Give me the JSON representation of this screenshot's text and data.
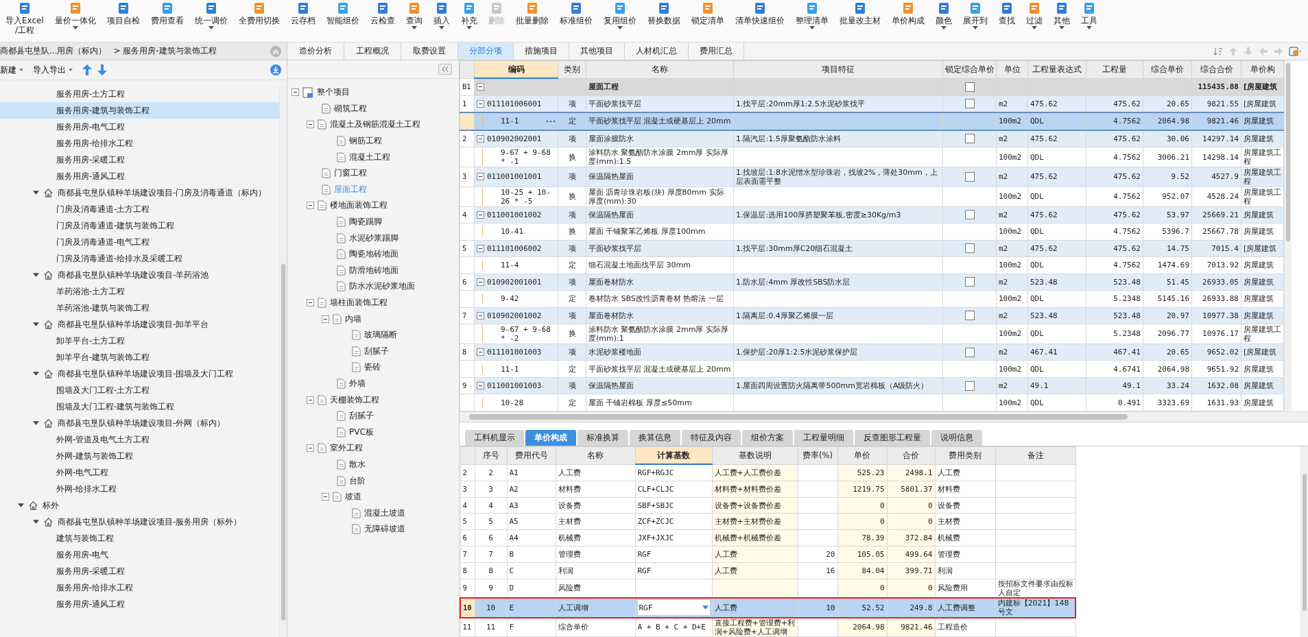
{
  "toolbar": [
    {
      "label": "导入Excel\n/工程",
      "dropdown": false,
      "disabled": false
    },
    {
      "label": "量价一体化",
      "dropdown": true,
      "disabled": false
    },
    {
      "label": "项目自检",
      "dropdown": false,
      "disabled": false
    },
    {
      "label": "费用查看",
      "dropdown": false,
      "disabled": false
    },
    {
      "label": "统一调价",
      "dropdown": true,
      "disabled": false
    },
    {
      "label": "全费用切换",
      "dropdown": false,
      "disabled": false
    },
    {
      "label": "云存档",
      "dropdown": false,
      "disabled": false
    },
    {
      "label": "智能组价",
      "dropdown": false,
      "disabled": false
    },
    {
      "label": "云检查",
      "dropdown": false,
      "disabled": false
    },
    {
      "label": "查询",
      "dropdown": true,
      "disabled": false
    },
    {
      "label": "插入",
      "dropdown": true,
      "disabled": false
    },
    {
      "label": "补充",
      "dropdown": true,
      "disabled": false
    },
    {
      "label": "删除",
      "dropdown": false,
      "disabled": true
    },
    {
      "label": "批量删除",
      "dropdown": false,
      "disabled": false
    },
    {
      "label": "标准组价",
      "dropdown": false,
      "disabled": false
    },
    {
      "label": "复用组价",
      "dropdown": true,
      "disabled": false
    },
    {
      "label": "替换数据",
      "dropdown": false,
      "disabled": false
    },
    {
      "label": "锁定清单",
      "dropdown": false,
      "disabled": false
    },
    {
      "label": "清单快速组价",
      "dropdown": false,
      "disabled": false
    },
    {
      "label": "整理清单",
      "dropdown": true,
      "disabled": false
    },
    {
      "label": "批量改主材",
      "dropdown": false,
      "disabled": false
    },
    {
      "label": "单价构成",
      "dropdown": false,
      "disabled": false
    },
    {
      "label": "颜色",
      "dropdown": true,
      "disabled": false
    },
    {
      "label": "展开到",
      "dropdown": true,
      "disabled": false
    },
    {
      "label": "查找",
      "dropdown": false,
      "disabled": false
    },
    {
      "label": "过滤",
      "dropdown": true,
      "disabled": false
    },
    {
      "label": "其他",
      "dropdown": true,
      "disabled": false
    },
    {
      "label": "工具",
      "dropdown": true,
      "disabled": false
    }
  ],
  "left_panel": {
    "breadcrumb": {
      "project": "商都县屯垦队...用房（标内）",
      "path": "> 服务用房-建筑与装饰工程"
    },
    "actions": [
      "新建",
      "导入导出"
    ],
    "tree": [
      {
        "children": [
          {
            "children": [
              {
                "label": "服务用房-土方工程",
                "selected": false
              },
              {
                "label": "服务用房-建筑与装饰工程",
                "selected": true
              },
              {
                "label": "服务用房-电气工程",
                "selected": false
              },
              {
                "label": "服务用房-给排水工程",
                "selected": false
              },
              {
                "label": "服务用房-采暖工程",
                "selected": false
              },
              {
                "label": "服务用房-通风工程",
                "selected": false
              }
            ]
          },
          {
            "label": "商都县屯垦队镇种羊场建设项目-门房及消毒通道（标内）",
            "selected": false,
            "expanded": true,
            "children": [
              {
                "label": "门房及消毒通道-土方工程",
                "selected": false
              },
              {
                "label": "门房及消毒通道-建筑与装饰工程",
                "selected": false
              },
              {
                "label": "门房及消毒通道-电气工程",
                "selected": false
              },
              {
                "label": "门房及消毒通道-给排水及采暖工程",
                "selected": false
              }
            ]
          },
          {
            "label": "商都县屯垦队镇种羊场建设项目-羊药浴池",
            "selected": false,
            "expanded": true,
            "children": [
              {
                "label": "羊药浴池-土方工程",
                "selected": false
              },
              {
                "label": "羊药浴池-建筑与装饰工程",
                "selected": false
              }
            ]
          },
          {
            "label": "商都县屯垦队镇种羊场建设项目-卸羊平台",
            "selected": false,
            "expanded": true,
            "children": [
              {
                "label": "卸羊平台-土方工程",
                "selected": false
              },
              {
                "label": "卸羊平台-建筑与装饰工程",
                "selected": false
              }
            ]
          },
          {
            "label": "商都县屯垦队镇种羊场建设项目-围墙及大门工程",
            "selected": false,
            "expanded": true,
            "children": [
              {
                "label": "围墙及大门工程-土方工程",
                "selected": false
              },
              {
                "label": "围墙及大门工程-建筑与装饰工程",
                "selected": false
              }
            ]
          },
          {
            "label": "商都县屯垦队镇种羊场建设项目-外网（标内）",
            "selected": false,
            "expanded": true,
            "children": [
              {
                "label": "外网-管道及电气土方工程",
                "selected": false
              },
              {
                "label": "外网-建筑与装饰工程",
                "selected": false
              },
              {
                "label": "外网-电气工程",
                "selected": false
              },
              {
                "label": "外网-给排水工程",
                "selected": false
              }
            ]
          }
        ]
      },
      {
        "label": "标外",
        "selected": false,
        "expanded": true,
        "children": [
          {
            "label": "商都县屯垦队镇种羊场建设项目-服务用房（标外）",
            "selected": false,
            "expanded": true,
            "children": [
              {
                "label": "建筑与装饰工程",
                "selected": false
              },
              {
                "label": "服务用房-电气",
                "selected": false
              },
              {
                "label": "服务用房-采暖工程",
                "selected": false
              },
              {
                "label": "服务用房-给排水工程",
                "selected": false
              },
              {
                "label": "服务用房-通风工程",
                "selected": false
              }
            ]
          }
        ]
      }
    ]
  },
  "tabs": [
    {
      "label": "造价分析",
      "selected": false
    },
    {
      "label": "工程概况",
      "selected": false
    },
    {
      "label": "取费设置",
      "selected": false
    },
    {
      "label": "分部分项",
      "selected": true
    },
    {
      "label": "措施项目",
      "selected": false
    },
    {
      "label": "其他项目",
      "selected": false
    },
    {
      "label": "人材机汇总",
      "selected": false
    },
    {
      "label": "费用汇总",
      "selected": false
    }
  ],
  "project_tree": [
    {
      "label": "整个项目",
      "kind": "root",
      "selected": false,
      "expanded": true,
      "children": [
        {
          "label": "砌筑工程",
          "selected": false
        },
        {
          "label": "混凝土及钢筋混凝土工程",
          "selected": false,
          "expanded": true,
          "children": [
            {
              "label": "钢筋工程",
              "selected": false
            },
            {
              "label": "混凝土工程",
              "selected": false
            }
          ]
        },
        {
          "label": "门窗工程",
          "selected": false
        },
        {
          "label": "屋面工程",
          "selected": true
        },
        {
          "label": "楼地面装饰工程",
          "selected": false,
          "expanded": true,
          "children": [
            {
              "label": "陶瓷踢脚",
              "selected": false
            },
            {
              "label": "水泥砂浆踢脚",
              "selected": false
            },
            {
              "label": "陶瓷地砖地面",
              "selected": false
            },
            {
              "label": "防滑地砖地面",
              "selected": false
            },
            {
              "label": "防水水泥砂浆地面",
              "selected": false
            }
          ]
        },
        {
          "label": "墙柱面装饰工程",
          "selected": false,
          "expanded": true,
          "children": [
            {
              "label": "内墙",
              "selected": false,
              "expanded": true,
              "children": [
                {
                  "label": "玻璃隔断",
                  "selected": false
                },
                {
                  "label": "刮腻子",
                  "selected": false
                },
                {
                  "label": "瓷砖",
                  "selected": false
                }
              ]
            },
            {
              "label": "外墙",
              "selected": false
            }
          ]
        },
        {
          "label": "天棚装饰工程",
          "selected": false,
          "expanded": true,
          "children": [
            {
              "label": "刮腻子",
              "selected": false
            },
            {
              "label": "PVC板",
              "selected": false
            }
          ]
        },
        {
          "label": "室外工程",
          "selected": false,
          "expanded": true,
          "children": [
            {
              "label": "散水",
              "selected": false
            },
            {
              "label": "台阶",
              "selected": false
            },
            {
              "label": "坡道",
              "selected": false,
              "expanded": true,
              "children": [
                {
                  "label": "混凝土坡道",
                  "selected": false
                },
                {
                  "label": "无障碍坡道",
                  "selected": false
                }
              ]
            }
          ]
        }
      ]
    }
  ],
  "upper_table": {
    "columns": [
      {
        "label": "编码",
        "active": true
      },
      {
        "label": "类别",
        "active": false
      },
      {
        "label": "名称",
        "active": false
      },
      {
        "label": "项目特征",
        "active": false
      },
      {
        "label": "锁定综合单价",
        "active": false
      },
      {
        "label": "单位",
        "active": false
      },
      {
        "label": "工程量表达式",
        "active": false
      },
      {
        "label": "工程量",
        "active": false
      },
      {
        "label": "综合单价",
        "active": false
      },
      {
        "label": "综合合价",
        "active": false
      },
      {
        "label": "单价构",
        "active": false
      }
    ],
    "rows": [
      {
        "kind": "group",
        "seq": "B1",
        "expanded": true,
        "name": "屋面工程",
        "locked": false,
        "total": "115435.88",
        "build": "[房屋建筑",
        "selected": false
      },
      {
        "kind": "item",
        "seq": "1",
        "expanded": true,
        "code": "011101006001",
        "type": "项",
        "name": "平面砂浆找平层",
        "feature": "1.找平层:20mm厚1:2.5水泥砂浆找平",
        "locked": false,
        "unit": "m2",
        "expr": "475.62",
        "qty": "475.62",
        "price": "20.65",
        "total": "9821.55",
        "build": "[房屋建筑",
        "selected": false
      },
      {
        "kind": "sub",
        "code": "11-1",
        "type": "定",
        "name": "平面砂浆找平层 混凝土或硬基层上 20mm",
        "unit": "100m2",
        "expr": "QDL",
        "qty": "4.7562",
        "price": "2064.98",
        "total": "9821.46",
        "build": "房屋建筑",
        "selected": true
      },
      {
        "kind": "item",
        "seq": "2",
        "expanded": true,
        "code": "010902002001",
        "type": "项",
        "name": "屋面涂膜防水",
        "feature": "1.隔汽层:1.5厚聚氨酯防水涂料",
        "locked": false,
        "unit": "m2",
        "expr": "475.62",
        "qty": "475.62",
        "price": "30.06",
        "total": "14297.14",
        "build": "房屋建筑",
        "selected": false
      },
      {
        "kind": "sub",
        "code": "9-67 + 9-68 * -1",
        "type": "换",
        "name": "涂料防水 聚氨酯防水涂膜 2mm厚  实际厚度(mm):1.5",
        "unit": "100m2",
        "expr": "QDL",
        "qty": "4.7562",
        "price": "3006.21",
        "total": "14298.14",
        "build": "房屋建筑工程",
        "selected": false
      },
      {
        "kind": "item",
        "seq": "3",
        "expanded": true,
        "code": "011001001001",
        "type": "项",
        "name": "保温隔热屋面",
        "feature": "1.找坡层:1:8水泥憎水型珍珠岩，找坡2%，薄处30mm，上层表面需平整",
        "locked": false,
        "unit": "m2",
        "expr": "475.62",
        "qty": "475.62",
        "price": "9.52",
        "total": "4527.9",
        "build": "房屋建筑工程",
        "selected": false
      },
      {
        "kind": "sub",
        "code": "10-25 + 10-26 * -5",
        "type": "换",
        "name": "屋面 沥青珍珠岩板(块) 厚度80mm  实际厚度(mm):30",
        "unit": "100m2",
        "expr": "QDL",
        "qty": "4.7562",
        "price": "952.07",
        "total": "4528.24",
        "build": "房屋建筑工程",
        "selected": false
      },
      {
        "kind": "item",
        "seq": "4",
        "expanded": true,
        "code": "011001001002",
        "type": "项",
        "name": "保温隔热屋面",
        "feature": "1.保温层:选用100厚挤塑聚苯板,密度≥30Kg/m3",
        "locked": false,
        "unit": "m2",
        "expr": "475.62",
        "qty": "475.62",
        "price": "53.97",
        "total": "25669.21",
        "build": "房屋建筑",
        "selected": false
      },
      {
        "kind": "sub",
        "code": "10-41",
        "type": "换",
        "name": "屋面 干铺聚苯乙烯板 厚度100mm",
        "unit": "100m2",
        "expr": "QDL",
        "qty": "4.7562",
        "price": "5396.7",
        "total": "25667.78",
        "build": "房屋建筑",
        "selected": false
      },
      {
        "kind": "item",
        "seq": "5",
        "expanded": true,
        "code": "011101006002",
        "type": "项",
        "name": "平面砂浆找平层",
        "feature": "1.找平层:30mm厚C20细石混凝土",
        "locked": false,
        "unit": "m2",
        "expr": "475.62",
        "qty": "475.62",
        "price": "14.75",
        "total": "7015.4",
        "build": "[房屋建筑",
        "selected": false
      },
      {
        "kind": "sub",
        "code": "11-4",
        "type": "定",
        "name": "细石混凝土地面找平层 30mm",
        "unit": "100m2",
        "expr": "QDL",
        "qty": "4.7562",
        "price": "1474.69",
        "total": "7013.92",
        "build": "房屋建筑",
        "selected": false
      },
      {
        "kind": "item",
        "seq": "6",
        "expanded": true,
        "code": "010902001001",
        "type": "项",
        "name": "屋面卷材防水",
        "feature": "1.防水层:4mm 厚改性SBS防水层",
        "locked": false,
        "unit": "m2",
        "expr": "523.48",
        "qty": "523.48",
        "price": "51.45",
        "total": "26933.05",
        "build": "房屋建筑",
        "selected": false
      },
      {
        "kind": "sub",
        "code": "9-42",
        "type": "定",
        "name": "卷材防水 SBS改性沥青卷材 热熔法 一层",
        "unit": "100m2",
        "expr": "QDL",
        "qty": "5.2348",
        "price": "5145.16",
        "total": "26933.88",
        "build": "房屋建筑",
        "selected": false
      },
      {
        "kind": "item",
        "seq": "7",
        "expanded": true,
        "code": "010902001002",
        "type": "项",
        "name": "屋面卷材防水",
        "feature": "1.隔离层:0.4厚聚乙烯膜一层",
        "locked": false,
        "unit": "m2",
        "expr": "523.48",
        "qty": "523.48",
        "price": "20.97",
        "total": "10977.38",
        "build": "房屋建筑",
        "selected": false
      },
      {
        "kind": "sub",
        "code": "9-67 + 9-68 * -2",
        "type": "换",
        "name": "涂料防水 聚氨酯防水涂膜 2mm厚  实际厚度(mm):1",
        "unit": "100m2",
        "expr": "QDL",
        "qty": "5.2348",
        "price": "2096.77",
        "total": "10976.17",
        "build": "房屋建筑工程",
        "selected": false
      },
      {
        "kind": "item",
        "seq": "8",
        "expanded": true,
        "code": "011101001003",
        "type": "项",
        "name": "水泥砂浆楼地面",
        "feature": "1.保护层:20厚1:2.5水泥砂浆保护层",
        "locked": false,
        "unit": "m2",
        "expr": "467.41",
        "qty": "467.41",
        "price": "20.65",
        "total": "9652.02",
        "build": "[房屋建筑",
        "selected": false
      },
      {
        "kind": "sub",
        "code": "11-1",
        "type": "定",
        "name": "平面砂浆找平层 混凝土或硬基层上 20mm",
        "unit": "100m2",
        "expr": "QDL",
        "qty": "4.6741",
        "price": "2064.98",
        "total": "9651.92",
        "build": "房屋建筑",
        "selected": false
      },
      {
        "kind": "item",
        "seq": "9",
        "expanded": true,
        "code": "011001001003",
        "type": "项",
        "name": "保温隔热屋面",
        "feature": "1.屋面四周设置防火隔离带500mm宽岩棉板（A级防火）",
        "locked": false,
        "unit": "m2",
        "expr": "49.1",
        "qty": "49.1",
        "price": "33.24",
        "total": "1632.08",
        "build": "房屋建筑",
        "selected": false
      },
      {
        "kind": "sub",
        "code": "10-28",
        "type": "定",
        "name": "屋面 干铺岩棉板 厚度≤50mm",
        "unit": "100m2",
        "expr": "QDL",
        "qty": "0.491",
        "price": "3323.69",
        "total": "1631.93",
        "build": "房屋建筑",
        "selected": false
      }
    ]
  },
  "detail_tabs": [
    {
      "label": "工料机显示",
      "selected": false
    },
    {
      "label": "单价构成",
      "selected": true
    },
    {
      "label": "标准换算",
      "selected": false
    },
    {
      "label": "换算信息",
      "selected": false
    },
    {
      "label": "特征及内容",
      "selected": false
    },
    {
      "label": "组价方案",
      "selected": false
    },
    {
      "label": "工程量明细",
      "selected": false
    },
    {
      "label": "反查图形工程量",
      "selected": false
    },
    {
      "label": "说明信息",
      "selected": false
    }
  ],
  "detail_table": {
    "columns": [
      {
        "label": "序号",
        "active": false
      },
      {
        "label": "费用代号",
        "active": false
      },
      {
        "label": "名称",
        "active": false
      },
      {
        "label": "计算基数",
        "active": true
      },
      {
        "label": "基数说明",
        "active": false
      },
      {
        "label": "费率(%)",
        "active": false
      },
      {
        "label": "单价",
        "active": false
      },
      {
        "label": "合价",
        "active": false
      },
      {
        "label": "费用类别",
        "active": false
      },
      {
        "label": "备注",
        "active": false
      }
    ],
    "rows": [
      {
        "no": "2",
        "seq": "2",
        "code": "A1",
        "name": "人工费",
        "base": "RGF+RGJC",
        "base_desc": "人工费+人工费价差",
        "price": "525.23",
        "total": "2498.1",
        "category": "人工费",
        "selected": false
      },
      {
        "no": "3",
        "seq": "3",
        "code": "A2",
        "name": "材料费",
        "base": "CLF+CLJC",
        "base_desc": "材料费+材料费价差",
        "price": "1219.75",
        "total": "5801.37",
        "category": "材料费",
        "selected": false
      },
      {
        "no": "4",
        "seq": "4",
        "code": "A3",
        "name": "设备费",
        "base": "SBF+SBJC",
        "base_desc": "设备费+设备费价差",
        "price": "0",
        "total": "0",
        "category": "设备费",
        "selected": false
      },
      {
        "no": "5",
        "seq": "5",
        "code": "A5",
        "name": "主材费",
        "base": "ZCF+ZCJC",
        "base_desc": "主材费+主材费价差",
        "price": "0",
        "total": "0",
        "category": "主材费",
        "selected": false
      },
      {
        "no": "6",
        "seq": "6",
        "code": "A4",
        "name": "机械费",
        "base": "JXF+JXJC",
        "base_desc": "机械费+机械费价差",
        "price": "78.39",
        "total": "372.84",
        "category": "机械费",
        "selected": false
      },
      {
        "no": "7",
        "seq": "7",
        "code": "B",
        "name": "管理费",
        "base": "RGF",
        "base_desc": "人工费",
        "rate": "20",
        "price": "105.05",
        "total": "499.64",
        "category": "管理费",
        "selected": false
      },
      {
        "no": "8",
        "seq": "8",
        "code": "C",
        "name": "利润",
        "base": "RGF",
        "base_desc": "人工费",
        "rate": "16",
        "price": "84.04",
        "total": "399.71",
        "category": "利润",
        "selected": false
      },
      {
        "no": "9",
        "seq": "9",
        "code": "D",
        "name": "风险费",
        "price": "0",
        "total": "0",
        "category": "风险费用",
        "note": "按招标文件要求由投标人自定",
        "selected": false
      },
      {
        "no": "10",
        "seq": "10",
        "code": "E",
        "name": "人工调增",
        "base": "RGF",
        "base_desc": "人工费",
        "rate": "10",
        "price": "52.52",
        "total": "249.8",
        "category": "人工费调整",
        "note": "内建标【2021】148号文",
        "selected": true
      },
      {
        "no": "11",
        "seq": "11",
        "code": "F",
        "name": "综合单价",
        "base": "A + B + C + D+E",
        "base_desc": "直接工程费+管理费+利润+风险费+人工调增",
        "price": "2064.98",
        "total": "9821.46",
        "category": "工程造价",
        "selected": false
      }
    ]
  }
}
